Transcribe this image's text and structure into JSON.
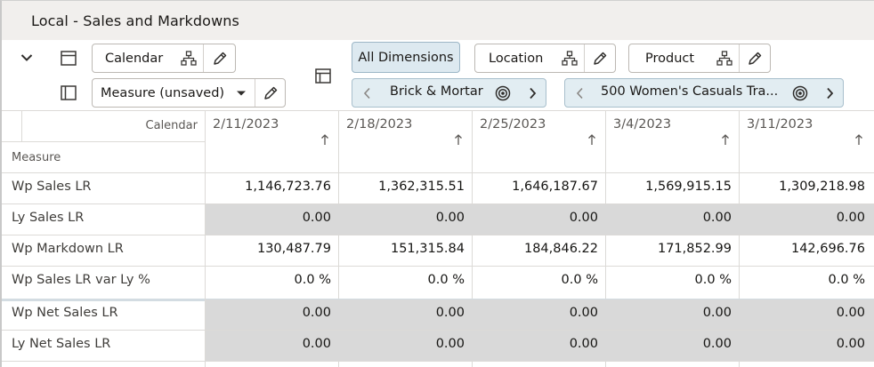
{
  "title": "Local - Sales and Markdowns",
  "toolbar": {
    "calendar_label": "Calendar",
    "measure_label": "Measure (unsaved)",
    "all_dimensions_label": "All Dimensions",
    "location_label": "Location",
    "product_label": "Product",
    "location_value": "Brick & Mortar",
    "product_value": "500 Women's Casuals Tra..."
  },
  "grid": {
    "corner_top": "Calendar",
    "corner_bottom": "Measure",
    "columns": [
      "2/11/2023",
      "2/18/2023",
      "2/25/2023",
      "3/4/2023",
      "3/11/2023"
    ],
    "rows": [
      {
        "label": "Wp Sales LR",
        "values": [
          "1,146,723.76",
          "1,362,315.51",
          "1,646,187.67",
          "1,569,915.15",
          "1,309,218.98"
        ],
        "gray": false
      },
      {
        "label": "Ly Sales LR",
        "values": [
          "0.00",
          "0.00",
          "0.00",
          "0.00",
          "0.00"
        ],
        "gray": true
      },
      {
        "label": "Wp Markdown LR",
        "values": [
          "130,487.79",
          "151,315.84",
          "184,846.22",
          "171,852.99",
          "142,696.76"
        ],
        "gray": false
      },
      {
        "label": "Wp Sales LR var Ly %",
        "values": [
          "0.0 %",
          "0.0 %",
          "0.0 %",
          "0.0 %",
          "0.0 %"
        ],
        "gray": false
      },
      {
        "label": "Wp Net Sales LR",
        "values": [
          "0.00",
          "0.00",
          "0.00",
          "0.00",
          "0.00"
        ],
        "gray": true
      },
      {
        "label": "Ly Net Sales LR",
        "values": [
          "0.00",
          "0.00",
          "0.00",
          "0.00",
          "0.00"
        ],
        "gray": true
      }
    ]
  }
}
